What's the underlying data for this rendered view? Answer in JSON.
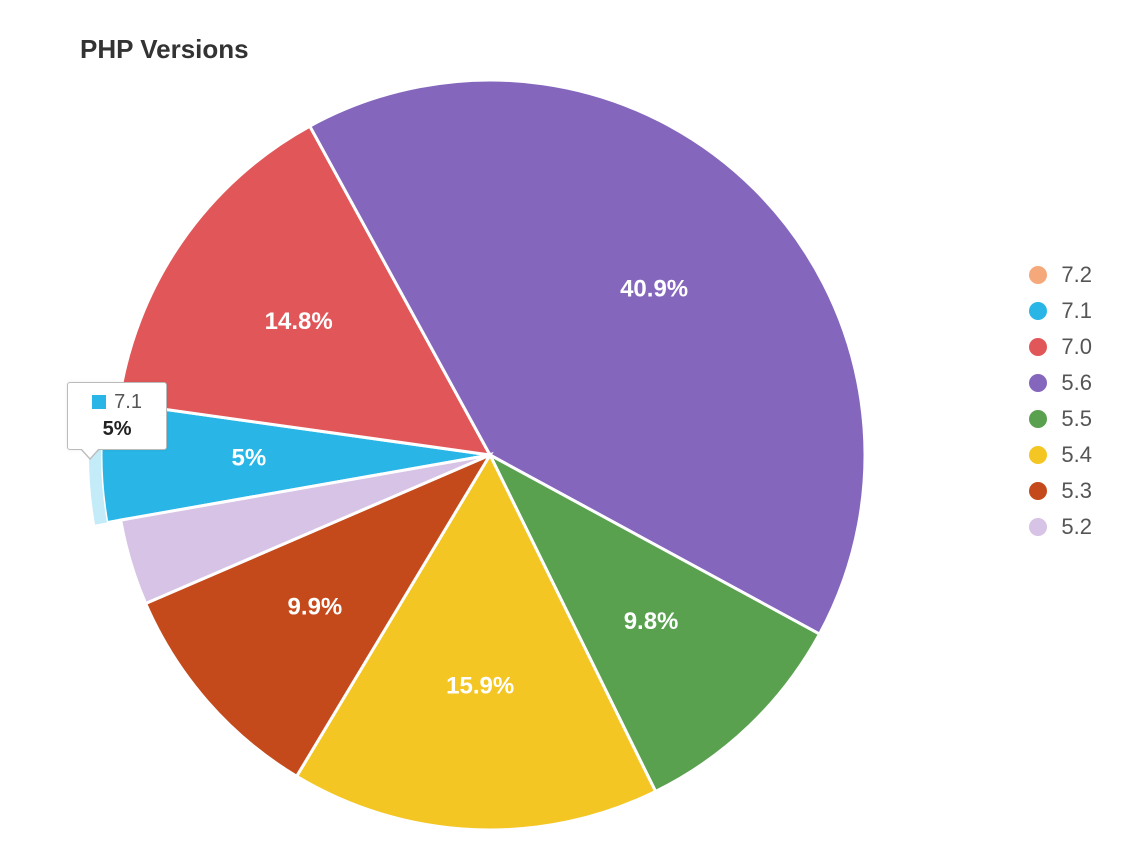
{
  "title": "PHP Versions",
  "chart_data": {
    "type": "pie",
    "title": "PHP Versions",
    "series": [
      {
        "name": "7.2",
        "value": 0.0,
        "color": "#f5a97a",
        "show_label": false
      },
      {
        "name": "7.1",
        "value": 5.0,
        "color": "#29b6e6",
        "show_label": true,
        "highlighted": true
      },
      {
        "name": "7.0",
        "value": 14.8,
        "color": "#e15759",
        "show_label": true
      },
      {
        "name": "5.6",
        "value": 40.9,
        "color": "#8467bd",
        "show_label": true
      },
      {
        "name": "5.5",
        "value": 9.8,
        "color": "#59a14f",
        "show_label": true
      },
      {
        "name": "5.4",
        "value": 15.9,
        "color": "#f3c623",
        "show_label": true
      },
      {
        "name": "5.3",
        "value": 9.9,
        "color": "#c44a1c",
        "show_label": true
      },
      {
        "name": "5.2",
        "value": 3.7,
        "color": "#d6c3e6",
        "show_label": false
      }
    ],
    "legend_position": "right",
    "start_angle_deg": -100
  },
  "tooltip": {
    "series_name": "7.1",
    "value_text": "5%",
    "swatch_color": "#29b6e6"
  }
}
